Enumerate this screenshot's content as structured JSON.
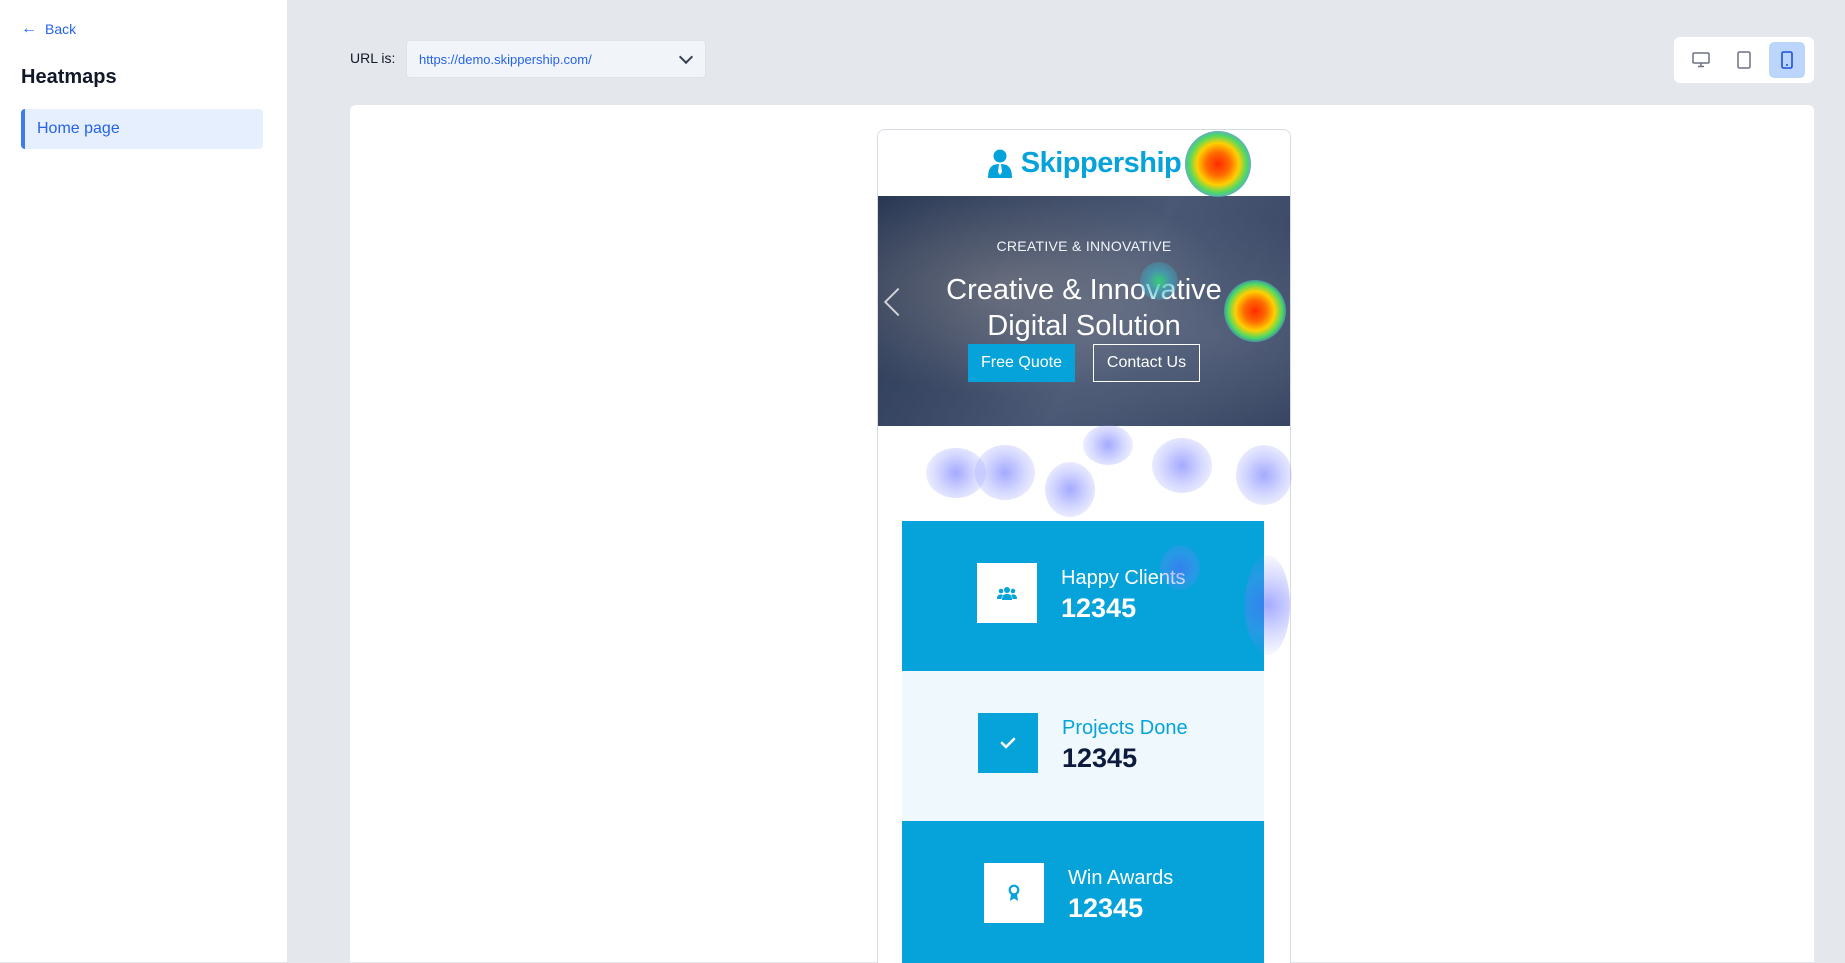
{
  "sidebar": {
    "back_label": "Back",
    "title": "Heatmaps",
    "items": [
      {
        "label": "Home page"
      }
    ]
  },
  "toolbar": {
    "url_label": "URL is:",
    "url_value": "https://demo.skippership.com/",
    "devices": [
      {
        "name": "desktop",
        "active": false
      },
      {
        "name": "tablet",
        "active": false
      },
      {
        "name": "mobile",
        "active": true
      }
    ]
  },
  "preview": {
    "logo_text": "Skippership",
    "hero": {
      "eyebrow": "CREATIVE & INNOVATIVE",
      "title_line1": "Creative & Innovative",
      "title_line2": "Digital Solution",
      "primary_button": "Free Quote",
      "secondary_button": "Contact Us"
    },
    "stats": [
      {
        "label": "Happy Clients",
        "value": "12345",
        "icon": "users-icon"
      },
      {
        "label": "Projects Done",
        "value": "12345",
        "icon": "check-icon"
      },
      {
        "label": "Win Awards",
        "value": "12345",
        "icon": "award-icon"
      }
    ]
  },
  "colors": {
    "accent": "#2563eb",
    "site_primary": "#06a3da",
    "site_dark": "#0d1b3d"
  }
}
